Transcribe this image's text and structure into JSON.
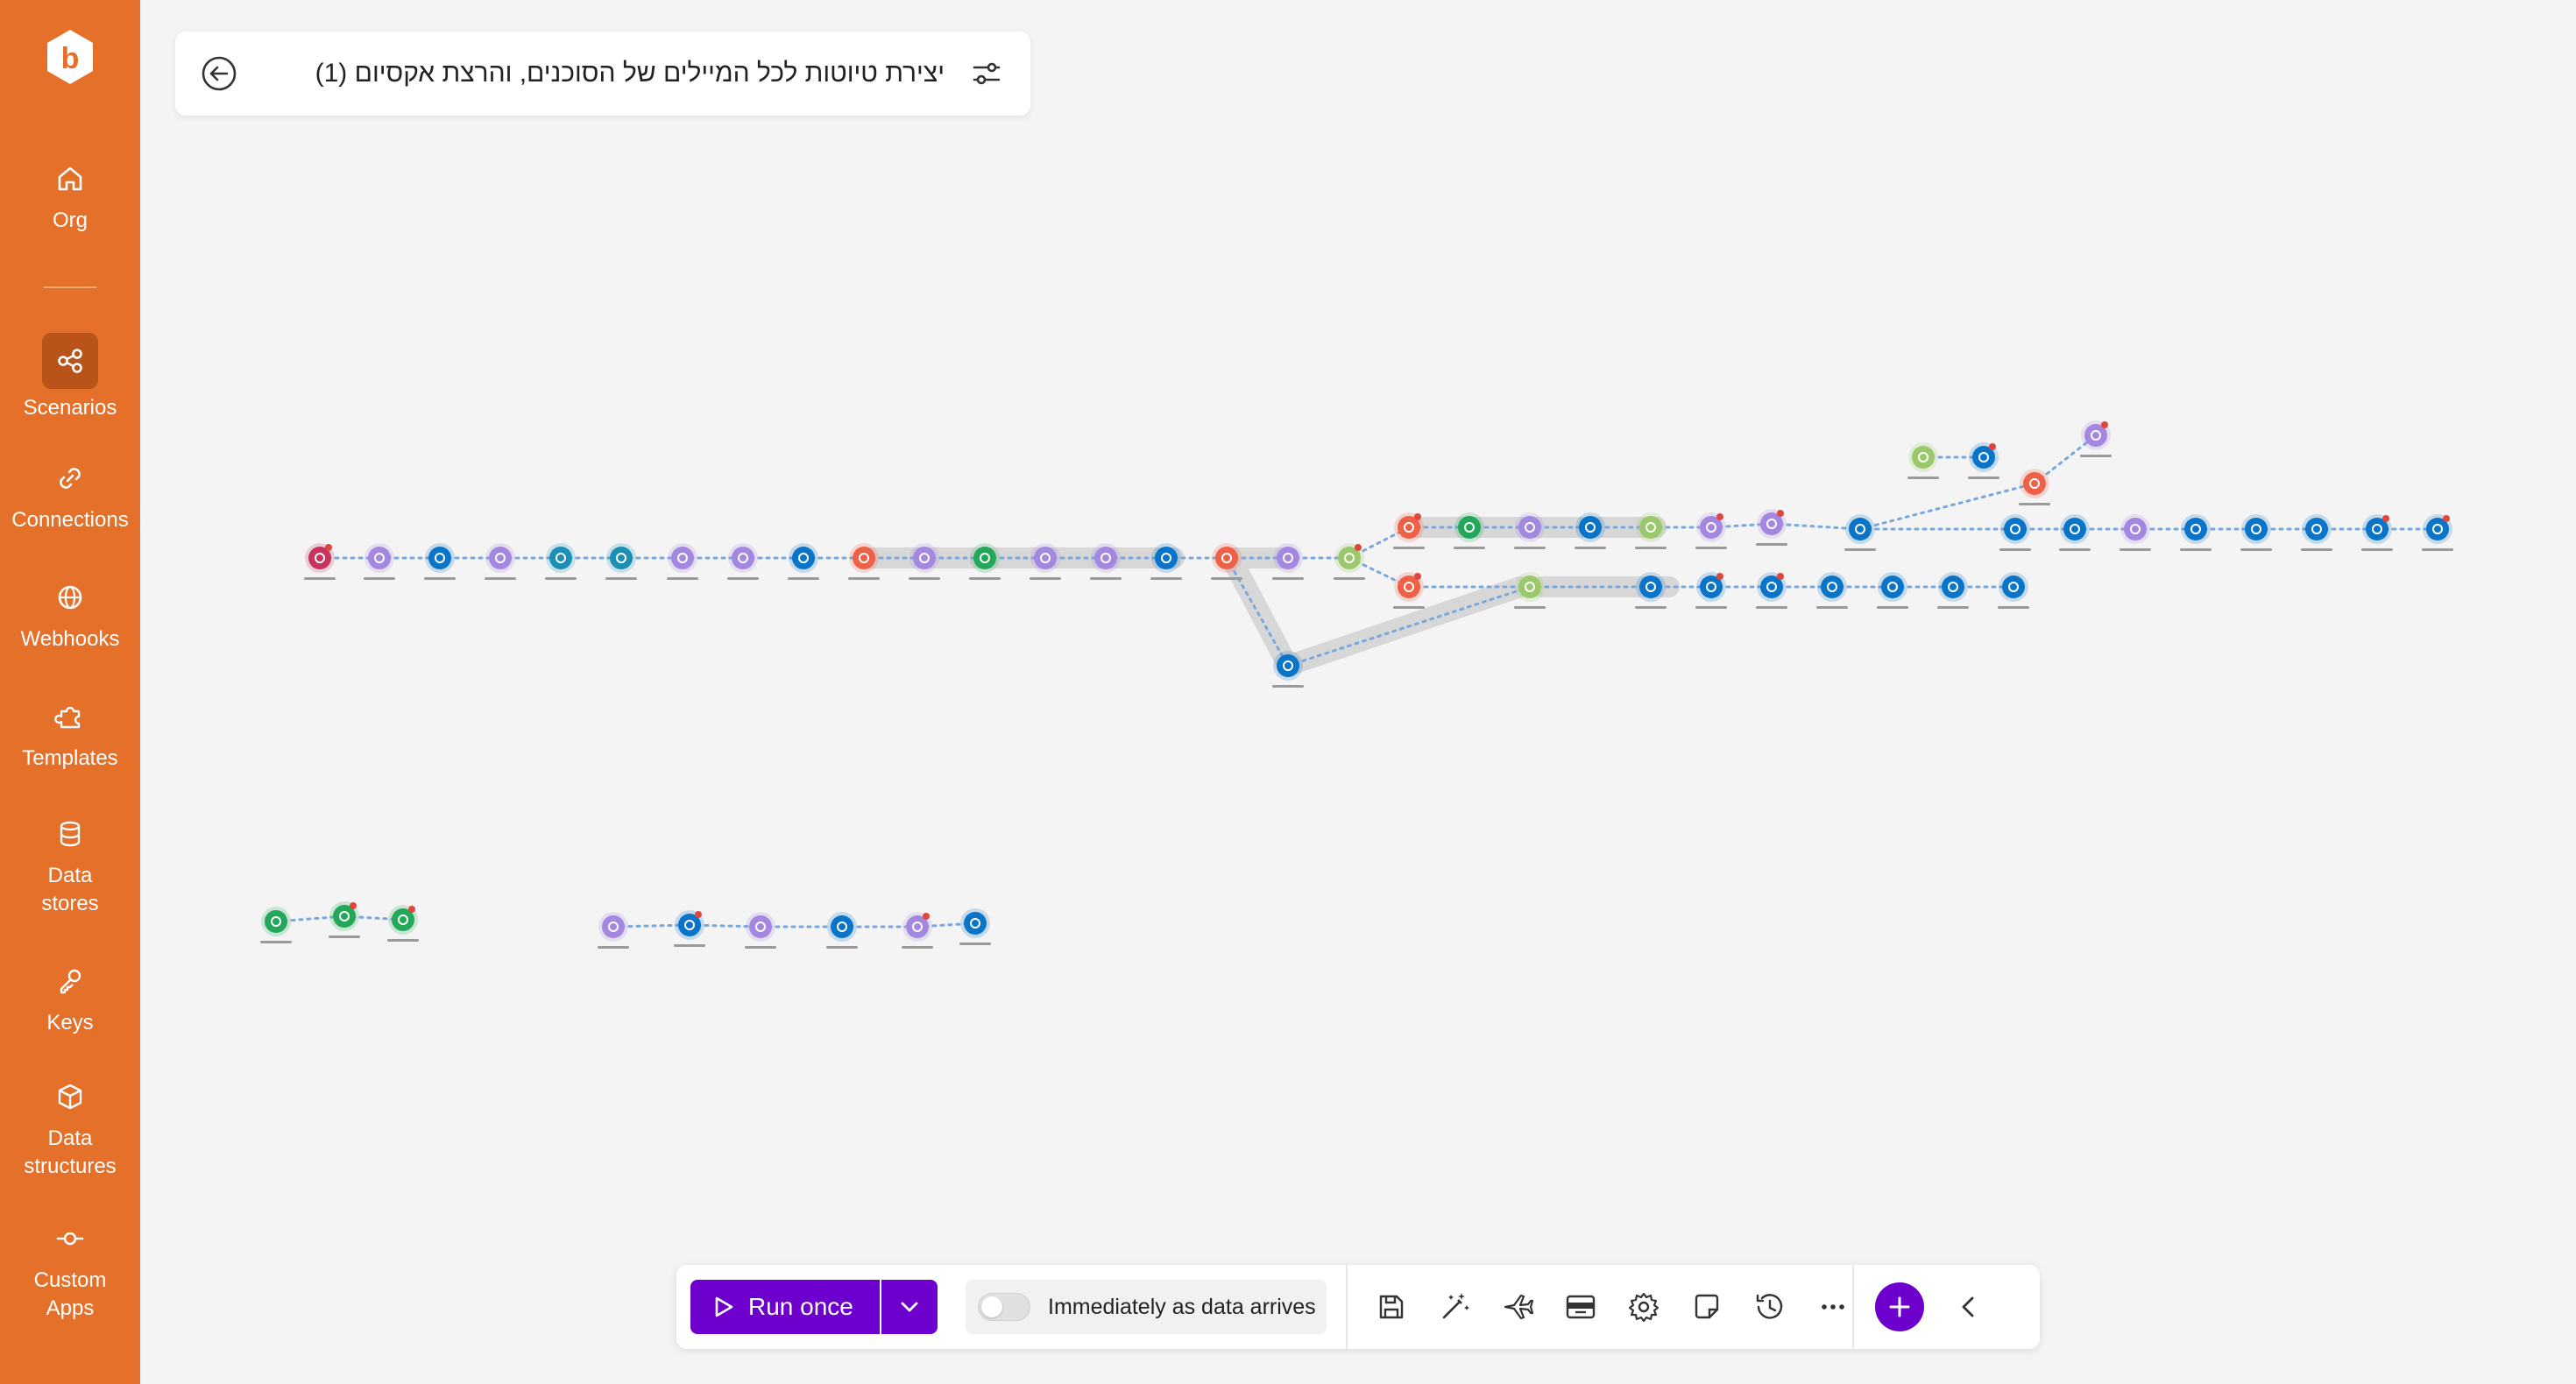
{
  "app": {
    "logo_letter": "b",
    "scenario_title": "יצירת טיוטות לכל המיילים של הסוכנים, והרצת אקסיום (1)"
  },
  "sidebar": {
    "items": [
      {
        "label": "Org",
        "icon": "home-icon"
      },
      {
        "label": "Scenarios",
        "icon": "share-nodes-icon",
        "active": true
      },
      {
        "label": "Connections",
        "icon": "link-icon"
      },
      {
        "label": "Webhooks",
        "icon": "globe-icon"
      },
      {
        "label": "Templates",
        "icon": "puzzle-icon"
      },
      {
        "label": "Data stores",
        "icon": "database-icon"
      },
      {
        "label": "Keys",
        "icon": "key-icon"
      },
      {
        "label": "Data structures",
        "icon": "cube-icon"
      },
      {
        "label": "Custom Apps",
        "icon": "connector-icon"
      }
    ]
  },
  "toolbar": {
    "run_label": "Run once",
    "schedule_label": "Immediately as data arrives",
    "icons": [
      "save-icon",
      "magic-wand-icon",
      "airplane-icon",
      "layout-icon",
      "gear-icon",
      "note-icon",
      "history-icon",
      "more-icon"
    ]
  },
  "colors": {
    "brand": "#e4702a",
    "run_button": "#6d00cc",
    "module_purple": "#a487e0",
    "module_blue": "#0a74c9",
    "module_red": "#ee6146",
    "module_green": "#23a85a",
    "module_lime": "#9ac96b",
    "module_teal": "#1b8fb5",
    "module_crimson": "#c8325c"
  }
}
